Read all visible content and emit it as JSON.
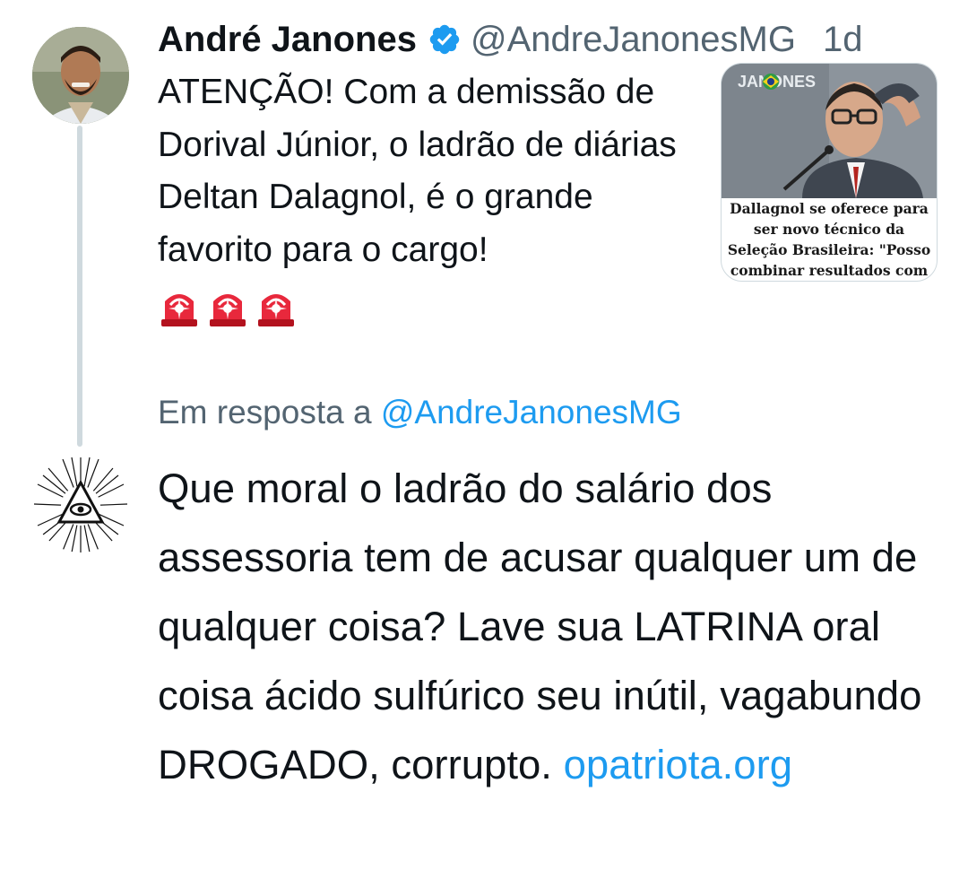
{
  "tweet": {
    "author_name": "André Janones",
    "handle": "@AndreJanonesMG",
    "time": "1d",
    "text": "ATENÇÃO! Com a demissão de Dorival Júnior, o ladrão de diárias Deltan Dalagnol, é o grande favorito para o cargo!",
    "emoji_count": 3,
    "media": {
      "brand_text": "JANONES",
      "caption": "Dallagnol se oferece para ser novo técnico da Seleção Brasileira: \"Posso combinar resultados com o juiz\""
    }
  },
  "reply": {
    "reply_to_prefix": "Em resposta a",
    "reply_to_handle": "@AndreJanonesMG",
    "text": "Que moral o ladrão do salário dos assessoria tem de acusar qualquer um de qualquer coisa? Lave sua LATRINA oral coisa ácido sulfúrico seu inútil, vagabundo DROGADO, corrupto.",
    "link_text": "opatriota.org"
  },
  "colors": {
    "text": "#0f1419",
    "secondary": "#536471",
    "accent": "#1d9bf0",
    "thread_line": "#cfd9de"
  },
  "icons": [
    "verified-badge-icon",
    "police-siren-icon"
  ]
}
